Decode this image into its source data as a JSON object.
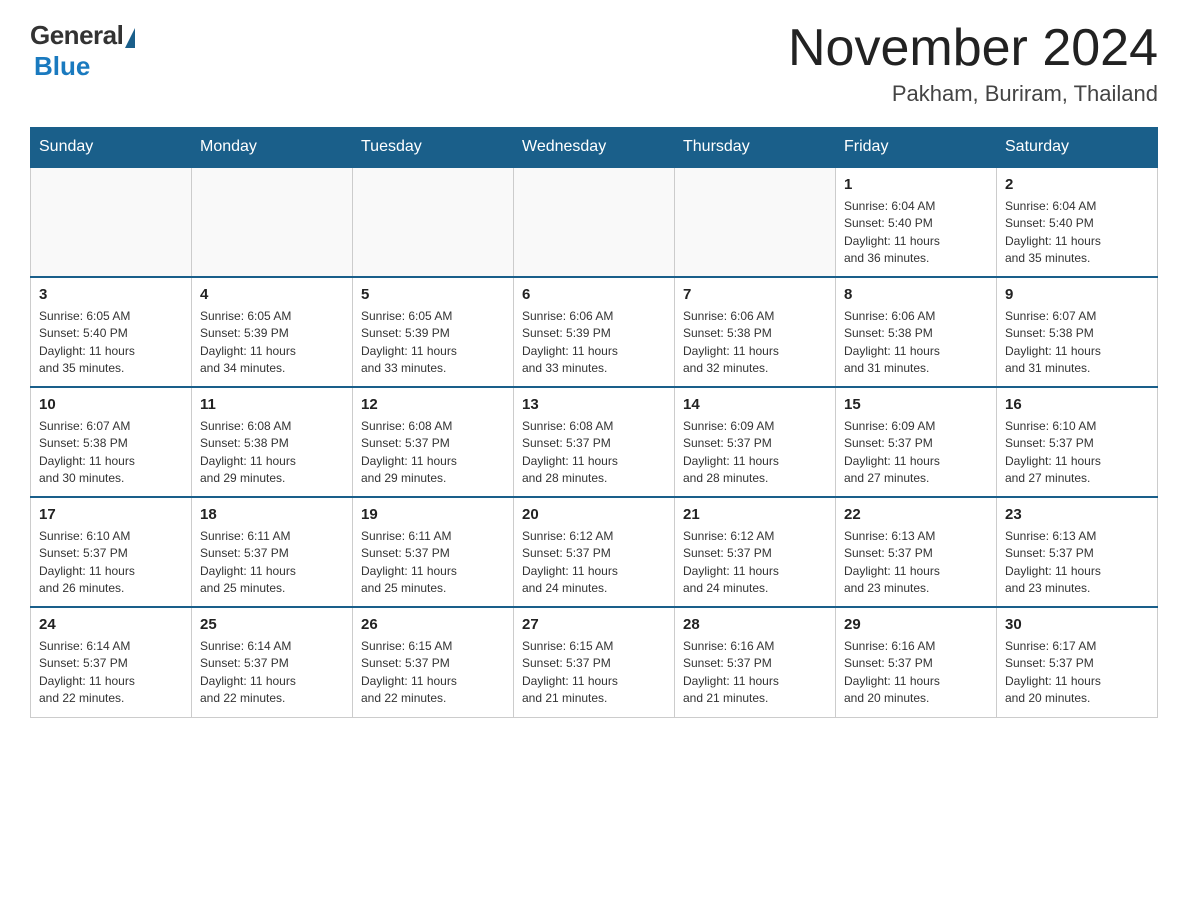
{
  "logo": {
    "general": "General",
    "blue": "Blue",
    "subtitle": "Blue"
  },
  "header": {
    "title": "November 2024",
    "location": "Pakham, Buriram, Thailand"
  },
  "days_of_week": [
    "Sunday",
    "Monday",
    "Tuesday",
    "Wednesday",
    "Thursday",
    "Friday",
    "Saturday"
  ],
  "weeks": [
    [
      {
        "day": "",
        "info": ""
      },
      {
        "day": "",
        "info": ""
      },
      {
        "day": "",
        "info": ""
      },
      {
        "day": "",
        "info": ""
      },
      {
        "day": "",
        "info": ""
      },
      {
        "day": "1",
        "info": "Sunrise: 6:04 AM\nSunset: 5:40 PM\nDaylight: 11 hours\nand 36 minutes."
      },
      {
        "day": "2",
        "info": "Sunrise: 6:04 AM\nSunset: 5:40 PM\nDaylight: 11 hours\nand 35 minutes."
      }
    ],
    [
      {
        "day": "3",
        "info": "Sunrise: 6:05 AM\nSunset: 5:40 PM\nDaylight: 11 hours\nand 35 minutes."
      },
      {
        "day": "4",
        "info": "Sunrise: 6:05 AM\nSunset: 5:39 PM\nDaylight: 11 hours\nand 34 minutes."
      },
      {
        "day": "5",
        "info": "Sunrise: 6:05 AM\nSunset: 5:39 PM\nDaylight: 11 hours\nand 33 minutes."
      },
      {
        "day": "6",
        "info": "Sunrise: 6:06 AM\nSunset: 5:39 PM\nDaylight: 11 hours\nand 33 minutes."
      },
      {
        "day": "7",
        "info": "Sunrise: 6:06 AM\nSunset: 5:38 PM\nDaylight: 11 hours\nand 32 minutes."
      },
      {
        "day": "8",
        "info": "Sunrise: 6:06 AM\nSunset: 5:38 PM\nDaylight: 11 hours\nand 31 minutes."
      },
      {
        "day": "9",
        "info": "Sunrise: 6:07 AM\nSunset: 5:38 PM\nDaylight: 11 hours\nand 31 minutes."
      }
    ],
    [
      {
        "day": "10",
        "info": "Sunrise: 6:07 AM\nSunset: 5:38 PM\nDaylight: 11 hours\nand 30 minutes."
      },
      {
        "day": "11",
        "info": "Sunrise: 6:08 AM\nSunset: 5:38 PM\nDaylight: 11 hours\nand 29 minutes."
      },
      {
        "day": "12",
        "info": "Sunrise: 6:08 AM\nSunset: 5:37 PM\nDaylight: 11 hours\nand 29 minutes."
      },
      {
        "day": "13",
        "info": "Sunrise: 6:08 AM\nSunset: 5:37 PM\nDaylight: 11 hours\nand 28 minutes."
      },
      {
        "day": "14",
        "info": "Sunrise: 6:09 AM\nSunset: 5:37 PM\nDaylight: 11 hours\nand 28 minutes."
      },
      {
        "day": "15",
        "info": "Sunrise: 6:09 AM\nSunset: 5:37 PM\nDaylight: 11 hours\nand 27 minutes."
      },
      {
        "day": "16",
        "info": "Sunrise: 6:10 AM\nSunset: 5:37 PM\nDaylight: 11 hours\nand 27 minutes."
      }
    ],
    [
      {
        "day": "17",
        "info": "Sunrise: 6:10 AM\nSunset: 5:37 PM\nDaylight: 11 hours\nand 26 minutes."
      },
      {
        "day": "18",
        "info": "Sunrise: 6:11 AM\nSunset: 5:37 PM\nDaylight: 11 hours\nand 25 minutes."
      },
      {
        "day": "19",
        "info": "Sunrise: 6:11 AM\nSunset: 5:37 PM\nDaylight: 11 hours\nand 25 minutes."
      },
      {
        "day": "20",
        "info": "Sunrise: 6:12 AM\nSunset: 5:37 PM\nDaylight: 11 hours\nand 24 minutes."
      },
      {
        "day": "21",
        "info": "Sunrise: 6:12 AM\nSunset: 5:37 PM\nDaylight: 11 hours\nand 24 minutes."
      },
      {
        "day": "22",
        "info": "Sunrise: 6:13 AM\nSunset: 5:37 PM\nDaylight: 11 hours\nand 23 minutes."
      },
      {
        "day": "23",
        "info": "Sunrise: 6:13 AM\nSunset: 5:37 PM\nDaylight: 11 hours\nand 23 minutes."
      }
    ],
    [
      {
        "day": "24",
        "info": "Sunrise: 6:14 AM\nSunset: 5:37 PM\nDaylight: 11 hours\nand 22 minutes."
      },
      {
        "day": "25",
        "info": "Sunrise: 6:14 AM\nSunset: 5:37 PM\nDaylight: 11 hours\nand 22 minutes."
      },
      {
        "day": "26",
        "info": "Sunrise: 6:15 AM\nSunset: 5:37 PM\nDaylight: 11 hours\nand 22 minutes."
      },
      {
        "day": "27",
        "info": "Sunrise: 6:15 AM\nSunset: 5:37 PM\nDaylight: 11 hours\nand 21 minutes."
      },
      {
        "day": "28",
        "info": "Sunrise: 6:16 AM\nSunset: 5:37 PM\nDaylight: 11 hours\nand 21 minutes."
      },
      {
        "day": "29",
        "info": "Sunrise: 6:16 AM\nSunset: 5:37 PM\nDaylight: 11 hours\nand 20 minutes."
      },
      {
        "day": "30",
        "info": "Sunrise: 6:17 AM\nSunset: 5:37 PM\nDaylight: 11 hours\nand 20 minutes."
      }
    ]
  ],
  "colors": {
    "header_bg": "#1a5f8a",
    "header_text": "#ffffff",
    "border": "#1a5f8a",
    "cell_border": "#cccccc"
  }
}
